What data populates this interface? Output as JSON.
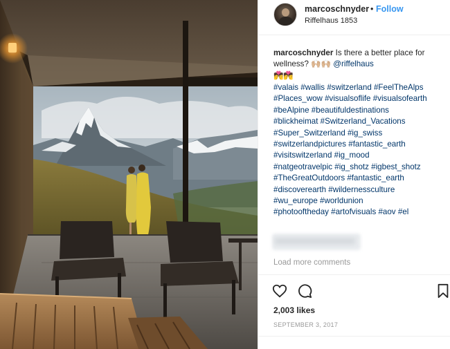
{
  "post": {
    "username": "marcoschnyder",
    "separator": "•",
    "follow_label": "Follow",
    "location": "Riffelhaus 1853"
  },
  "caption": {
    "username": "marcoschnyder",
    "text": "Is there a better place for wellness? 🙌🏼🙌🏼",
    "mention": "@riffelhaus",
    "emoji_line": "💏💏"
  },
  "hashtags": [
    "#valais #wallis #switzerland #FeelTheAlps",
    "#Places_wow #visualsoflife #visualsofearth",
    "#beAlpine #beautifuldestinations",
    "#blickheimat #Switzerland_Vacations",
    "#Super_Switzerland #ig_swiss",
    "#switzerlandpictures #fantastic_earth",
    "#visitswitzerland #ig_mood",
    "#natgeotravelpic #ig_shotz #igbest_shotz",
    "#TheGreatOutdoors #fantastic_earth",
    "#discoverearth #wildernessculture",
    "#wu_europe #worldunion",
    "#photooftheday #artofvisuals #aov #el"
  ],
  "comments": {
    "load_more": "Load more comments"
  },
  "stats": {
    "likes": "2,003 likes",
    "date": "SEPTEMBER 3, 2017"
  },
  "icons": {
    "like": "heart-icon",
    "comment": "comment-icon",
    "save": "bookmark-icon"
  },
  "colors": {
    "link": "#003569",
    "follow": "#3897f0",
    "meta": "#999999"
  }
}
